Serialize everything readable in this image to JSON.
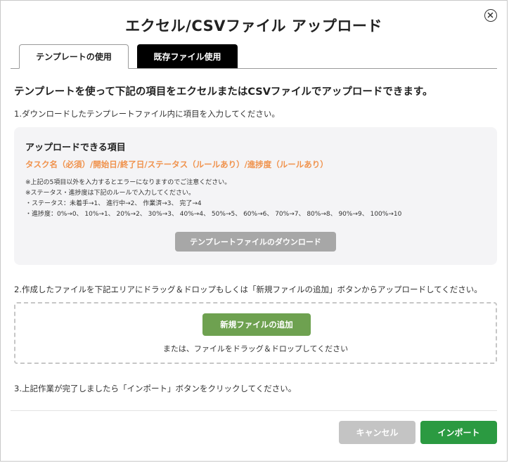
{
  "dialog": {
    "title": "エクセル/CSVファイル アップロード",
    "close_icon": "close-circle-icon"
  },
  "tabs": [
    {
      "label": "テンプレートの使用",
      "active": true
    },
    {
      "label": "既存ファイル使用",
      "active": false
    }
  ],
  "lead_text": "テンプレートを使って下記の項目をエクセルまたはCSVファイルでアップロードできます。",
  "steps": {
    "step1": "1.ダウンロードしたテンプレートファイル内に項目を入力してください。",
    "step2": "2.作成したファイルを下記エリアにドラッグ＆ドロップもしくは「新規ファイルの追加」ボタンからアップロードしてください。",
    "step3": "3.上記作業が完了しましたら「インポート」ボタンをクリックしてください。"
  },
  "info_box": {
    "heading": "アップロードできる項目",
    "items": "タスク名（必須）/開始日/終了日/ステータス（ルールあり）/進捗度（ルールあり）",
    "notes": [
      "※上記の5項目以外を入力するとエラーになりますのでご注意ください。",
      "※ステータス・進捗度は下記のルールで入力してください。",
      "・ステータス：未着手→1、 進行中→2、 作業済→3、 完了→4",
      "・進捗度：0%→0、 10%→1、 20%→2、 30%→3、 40%→4、 50%→5、 60%→6、 70%→7、 80%→8、 90%→9、 100%→10"
    ],
    "download_button": "テンプレートファイルのダウンロード"
  },
  "drop_area": {
    "add_button": "新規ファイルの追加",
    "hint": "または、ファイルをドラッグ＆ドロップしてください"
  },
  "footer": {
    "cancel_label": "キャンセル",
    "import_label": "インポート"
  },
  "colors": {
    "accent_orange": "#f0924c",
    "add_button_green": "#6ea150",
    "import_green": "#2b9a41",
    "disabled_gray": "#c4c4c4",
    "active_tab_black": "#000000"
  }
}
